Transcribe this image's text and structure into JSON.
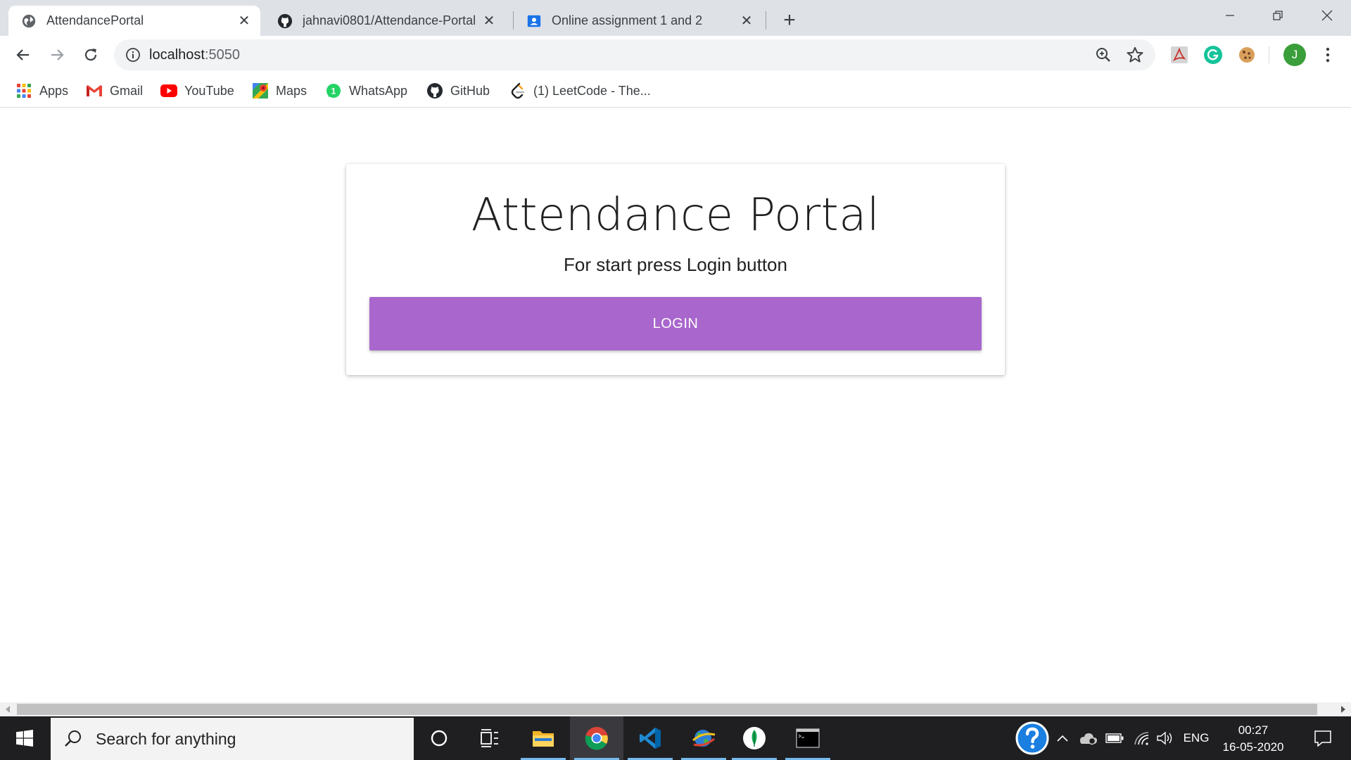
{
  "tabs": [
    {
      "title": "AttendancePortal",
      "icon": "globe-icon",
      "active": true
    },
    {
      "title": "jahnavi0801/Attendance-Portal",
      "icon": "github-icon",
      "active": false
    },
    {
      "title": "Online assignment 1 and 2",
      "icon": "contact-card-icon",
      "active": false
    }
  ],
  "tab_close_glyph": "✕",
  "new_tab_glyph": "+",
  "address_bar": {
    "host": "localhost",
    "port": ":5050"
  },
  "bookmarks": [
    {
      "label": "Apps",
      "icon": "apps-grid-icon"
    },
    {
      "label": "Gmail",
      "icon": "gmail-icon"
    },
    {
      "label": "YouTube",
      "icon": "youtube-icon"
    },
    {
      "label": "Maps",
      "icon": "maps-icon"
    },
    {
      "label": "WhatsApp",
      "icon": "whatsapp-icon"
    },
    {
      "label": "GitHub",
      "icon": "github-icon"
    },
    {
      "label": "(1) LeetCode - The...",
      "icon": "leetcode-icon"
    }
  ],
  "profile_initial": "J",
  "page": {
    "title": "Attendance Portal",
    "subtitle": "For start press Login button",
    "login_label": "LOGIN",
    "accent_color": "#a966cd"
  },
  "taskbar": {
    "search_placeholder": "Search for anything",
    "language": "ENG",
    "time": "00:27",
    "date": "16-05-2020"
  }
}
